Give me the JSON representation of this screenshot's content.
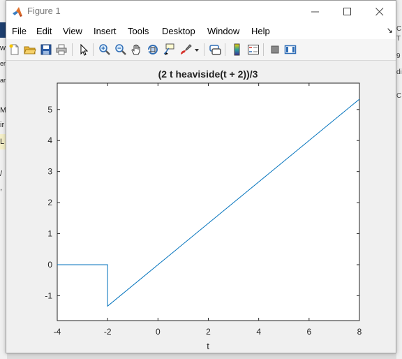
{
  "window": {
    "title": "Figure 1",
    "controls": {
      "minimize": "minimize",
      "maximize": "maximize",
      "close": "close"
    }
  },
  "menu": {
    "items": [
      "File",
      "Edit",
      "View",
      "Insert",
      "Tools",
      "Desktop",
      "Window",
      "Help"
    ],
    "overflow": "↘"
  },
  "toolbar": {
    "icons": [
      "new-figure-icon",
      "open-file-icon",
      "save-icon",
      "print-icon",
      "edit-plot-arrow-icon",
      "zoom-in-icon",
      "zoom-out-icon",
      "pan-hand-icon",
      "rotate-3d-icon",
      "data-cursor-icon",
      "brush-icon",
      "brush-dropdown-icon",
      "link-plot-icon",
      "insert-colorbar-icon",
      "insert-legend-icon",
      "hide-plot-tools-icon",
      "show-plot-tools-icon"
    ]
  },
  "background": {
    "left_chars": [
      "w",
      "en",
      "ar",
      "M",
      "ir",
      "L",
      "/",
      ","
    ],
    "right_chars": [
      "C",
      "T",
      "9",
      "di",
      "C"
    ]
  },
  "chart_data": {
    "type": "line",
    "title": "(2 t heaviside(t + 2))/3",
    "xlabel": "t",
    "ylabel": "",
    "xlim": [
      -4,
      8
    ],
    "ylim": [
      -1.8,
      5.85
    ],
    "xticks": [
      -4,
      -2,
      0,
      2,
      4,
      6,
      8
    ],
    "yticks": [
      -1,
      0,
      1,
      2,
      3,
      4,
      5
    ],
    "grid": false,
    "line_color": "#0072bd",
    "series": [
      {
        "x": [
          -4,
          -2,
          -2,
          8
        ],
        "y": [
          0,
          0,
          -1.3333,
          5.3333
        ]
      }
    ]
  }
}
